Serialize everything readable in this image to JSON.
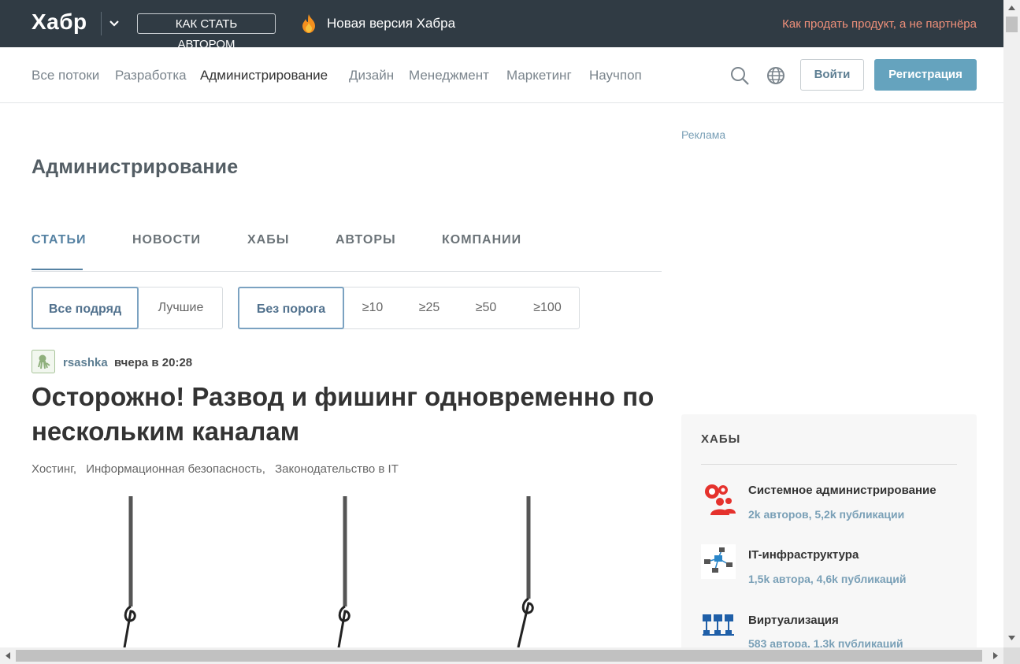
{
  "topbar": {
    "logo": "Хабр",
    "author_button": "КАК СТАТЬ АВТОРОМ",
    "new_version": "Новая версия Хабра",
    "promo": "Как продать продукт, а не партнёра"
  },
  "nav": {
    "items": [
      "Все потоки",
      "Разработка",
      "Администрирование",
      "Дизайн",
      "Менеджмент",
      "Маркетинг",
      "Научпоп"
    ],
    "active_index": 2,
    "login": "Войти",
    "register": "Регистрация"
  },
  "page": {
    "title": "Администрирование",
    "tabs": [
      "СТАТЬИ",
      "НОВОСТИ",
      "ХАБЫ",
      "АВТОРЫ",
      "КОМПАНИИ"
    ],
    "sort": [
      "Все подряд",
      "Лучшие"
    ],
    "thresholds": [
      "Без порога",
      "≥10",
      "≥25",
      "≥50",
      "≥100"
    ]
  },
  "post": {
    "author": "rsashka",
    "time": "вчера в 20:28",
    "title": "Осторожно! Развод и фишинг одновременно по нескольким каналам",
    "hubs": [
      "Хостинг,",
      "Информационная безопасность,",
      "Законодательство в IT"
    ]
  },
  "sidebar": {
    "ad_label": "Реклама",
    "hubs_title": "ХАБЫ",
    "hubs": [
      {
        "name": "Системное администрирование",
        "stats": "2k авторов, 5,2k публикации",
        "icon": "gears-people-icon"
      },
      {
        "name": "IT-инфраструктура",
        "stats": "1,5k автора, 4,6k публикаций",
        "icon": "network-icon"
      },
      {
        "name": "Виртуализация",
        "stats": "583 автора, 1,3k публикаций",
        "icon": "servers-icon"
      }
    ]
  },
  "colors": {
    "topbar_bg": "#303b44",
    "accent": "#5682a3",
    "register_bg": "#65a3be",
    "promo": "#f0907a"
  }
}
